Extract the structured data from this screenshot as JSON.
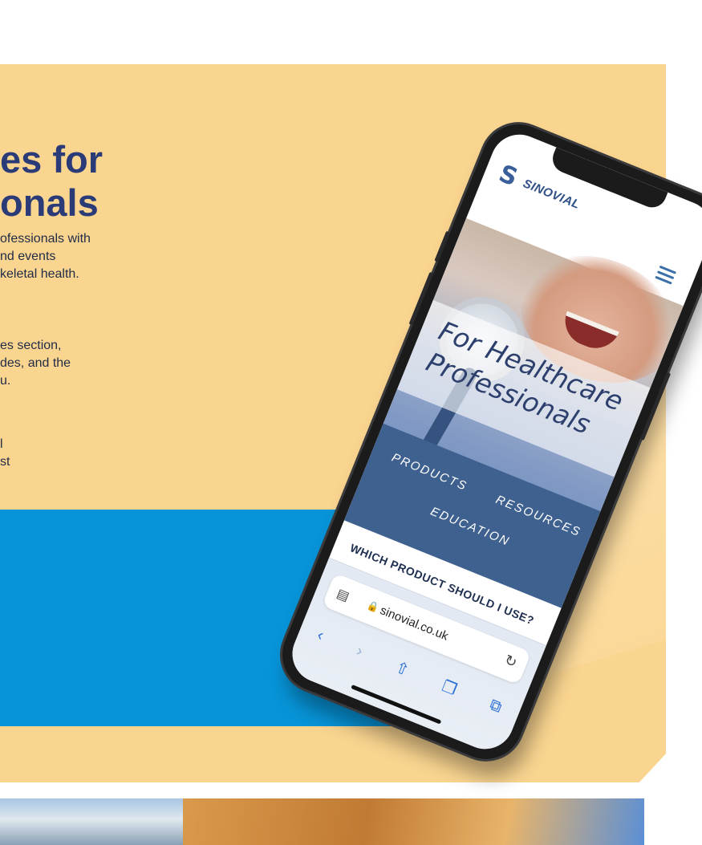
{
  "promo": {
    "heading_line1": "es for",
    "heading_line2": "onals",
    "para1": [
      "ofessionals with",
      "nd events",
      "keletal health."
    ],
    "para2": [
      "es section,",
      "des, and the",
      "u."
    ],
    "para3": [
      "l",
      "st"
    ]
  },
  "colors": {
    "panel": "#fad590",
    "blue_block": "#0794d8",
    "heading": "#2a3b78",
    "nav_band": "#3f6190"
  },
  "phone": {
    "brand": "SINOVIAL",
    "brand_mark": "S",
    "menu_icon": "hamburger-icon",
    "hero_title_line1": "For Healthcare",
    "hero_title_line2": "Professionals",
    "nav": {
      "products": "PRODUCTS",
      "resources": "RESOURCES",
      "education": "EDUCATION"
    },
    "question": "WHICH PRODUCT SHOULD I USE?",
    "browser": {
      "url": "sinovial.co.uk",
      "icons": [
        "reader-icon",
        "lock-icon",
        "reload-icon",
        "back-icon",
        "forward-icon",
        "share-icon",
        "bookmarks-icon",
        "tabs-icon"
      ]
    }
  }
}
